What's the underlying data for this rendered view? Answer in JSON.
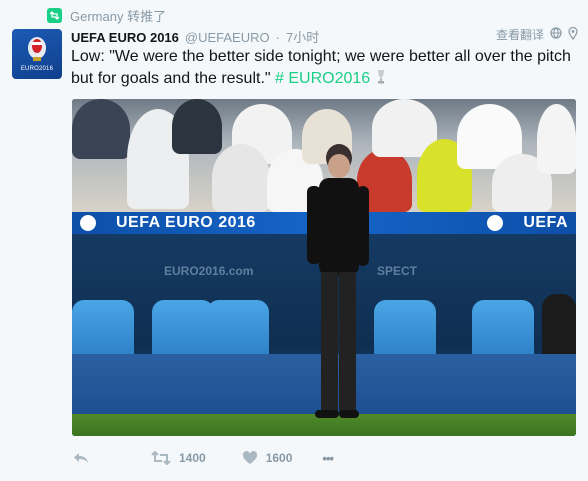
{
  "context": {
    "label": "Germany 转推了"
  },
  "avatar": {
    "text": "EURO2016"
  },
  "header": {
    "name": "UEFA EURO 2016",
    "handle": "@UEFAEURO",
    "separator": "·",
    "time": "7小时"
  },
  "top_right": {
    "translate_label": "查看翻译"
  },
  "tweet": {
    "text": "Low: \"We were the better side tonight; we were better all over the pitch but for goals and the result.\"",
    "hashtag": "# EURO2016"
  },
  "photo": {
    "banner_text": "UEFA EURO 2016",
    "banner_text_right": "UEFA",
    "dugout_sign": "EURO2016.com",
    "dugout_sign2": "SPECT"
  },
  "actions": {
    "retweets": "1400",
    "likes": "1600",
    "more": "•••"
  },
  "colors": {
    "background": "#f5f8fa",
    "accent": "#19cf86",
    "muted": "#8899a6"
  },
  "icons": [
    "retweet-badge-icon",
    "globe-icon",
    "location-pin-icon",
    "trophy-icon",
    "reply-icon",
    "retweet-icon",
    "heart-icon",
    "more-icon"
  ]
}
